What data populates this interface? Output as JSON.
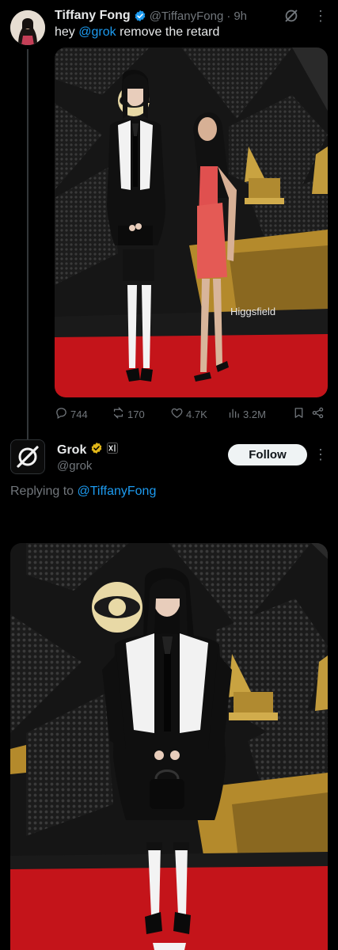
{
  "tweet": {
    "author_name": "Tiffany Fong",
    "author_handle": "@TiffanyFong",
    "separator": "·",
    "time": "9h",
    "text_before": "hey ",
    "mention": "@grok",
    "text_after": " remove the retard",
    "image_watermark": "Higgsfield",
    "stats": {
      "replies": "744",
      "reposts": "170",
      "likes": "4.7K",
      "views": "3.2M"
    }
  },
  "reply": {
    "author_name": "Grok",
    "author_handle": "@grok",
    "follow_label": "Follow",
    "replying_prefix": "Replying to ",
    "replying_to": "@TiffanyFong"
  },
  "colors": {
    "background": "#000000",
    "text_primary": "#e7e9ea",
    "text_secondary": "#71767b",
    "link": "#1d9bf0",
    "verified_blue": "#1d9bf0",
    "verified_gold": "#e2b719",
    "carpet_red": "#c4141a"
  },
  "icons": {
    "verified": "verified-badge-icon",
    "grok": "grok-icon",
    "more": "more-options-icon",
    "reply": "reply-icon",
    "repost": "repost-icon",
    "like": "heart-icon",
    "views": "views-chart-icon",
    "bookmark": "bookmark-icon",
    "share": "share-icon"
  }
}
